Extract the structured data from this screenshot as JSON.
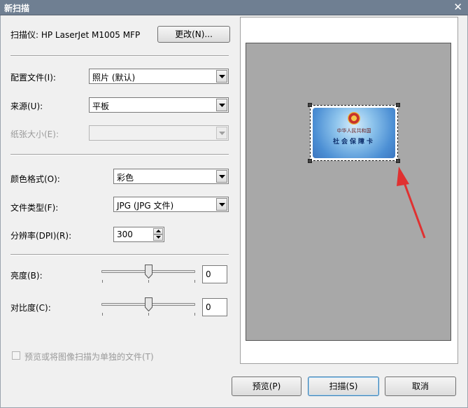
{
  "window": {
    "title": "新扫描",
    "close_glyph": "✕"
  },
  "scanner": {
    "label": "扫描仪: HP LaserJet M1005 MFP",
    "change_button": "更改(N)..."
  },
  "profile": {
    "label": "配置文件(I):",
    "value": "照片 (默认)"
  },
  "source": {
    "label": "来源(U):",
    "value": "平板"
  },
  "paper_size": {
    "label": "纸张大小(E):",
    "value": ""
  },
  "color_format": {
    "label": "颜色格式(O):",
    "value": "彩色"
  },
  "file_type": {
    "label": "文件类型(F):",
    "value": "JPG (JPG 文件)"
  },
  "resolution": {
    "label": "分辨率(DPI)(R):",
    "value": "300"
  },
  "brightness": {
    "label": "亮度(B):",
    "value": "0"
  },
  "contrast": {
    "label": "对比度(C):",
    "value": "0"
  },
  "separate_files": {
    "label": "预览或将图像扫描为单独的文件(T)",
    "checked": false
  },
  "buttons": {
    "preview": "预览(P)",
    "scan": "扫描(S)",
    "cancel": "取消"
  },
  "preview_card": {
    "subtitle": "中华人民共和国",
    "title": "社会保障卡"
  },
  "colors": {
    "title_bar": "#6f7f92",
    "preview_bg": "#a8a8a8",
    "arrow": "#e03131"
  }
}
